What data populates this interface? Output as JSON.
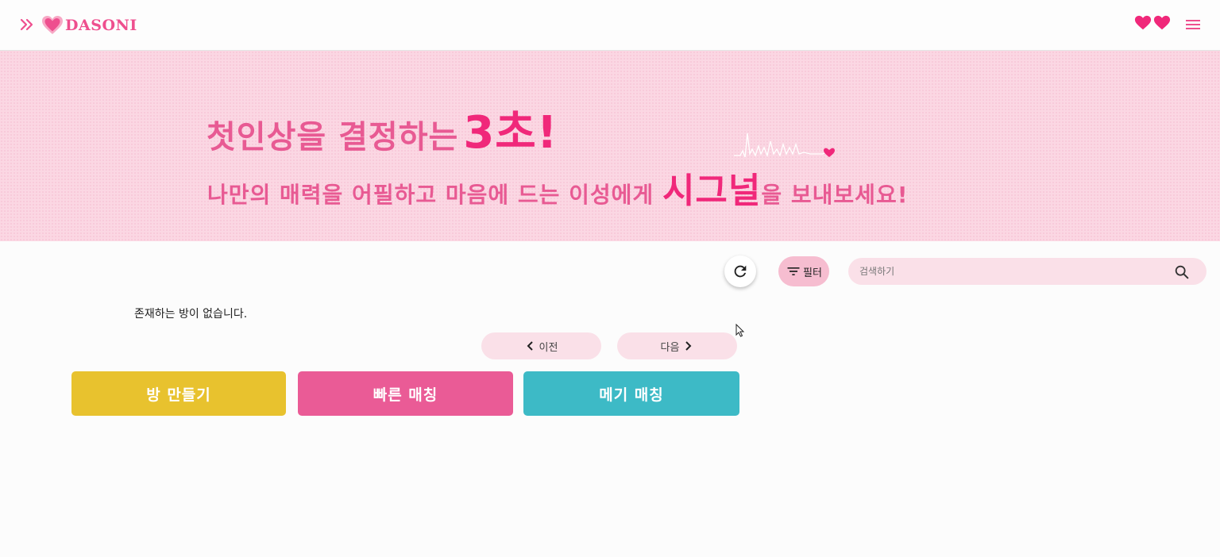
{
  "header": {
    "logo_text": "DASONI",
    "icons": [
      "expand-icon",
      "heart-logo-icon",
      "heart-icon",
      "heart-icon",
      "menu-icon"
    ],
    "colors": {
      "brand": "#ee4f8e"
    }
  },
  "banner": {
    "line1_text": "첫인상을 결정하는",
    "line1_emphasis": "3초!",
    "line2_before": "나만의 매력을 어필하고 마음에 드는 이성에게",
    "line2_emphasis": "시그널",
    "line2_after": "을 보내보세요!",
    "colors": {
      "background": "#fbd7e3",
      "text": "#e85a93",
      "emphasis": "#f0287a"
    }
  },
  "controls": {
    "refresh_icon": "refresh-icon",
    "filter_label": "필터",
    "filter_icon": "filter-icon",
    "search_placeholder": "검색하기",
    "search_icon": "search-icon"
  },
  "room_list": {
    "empty_message": "존재하는 방이 없습니다."
  },
  "pagination": {
    "prev_label": "이전",
    "next_label": "다음"
  },
  "actions": {
    "create_room_label": "방 만들기",
    "quick_match_label": "빠른 매칭",
    "mega_match_label": "메기 매칭",
    "colors": {
      "create": "#e8c22e",
      "quick": "#ea5b96",
      "mega": "#3dbac6"
    }
  }
}
